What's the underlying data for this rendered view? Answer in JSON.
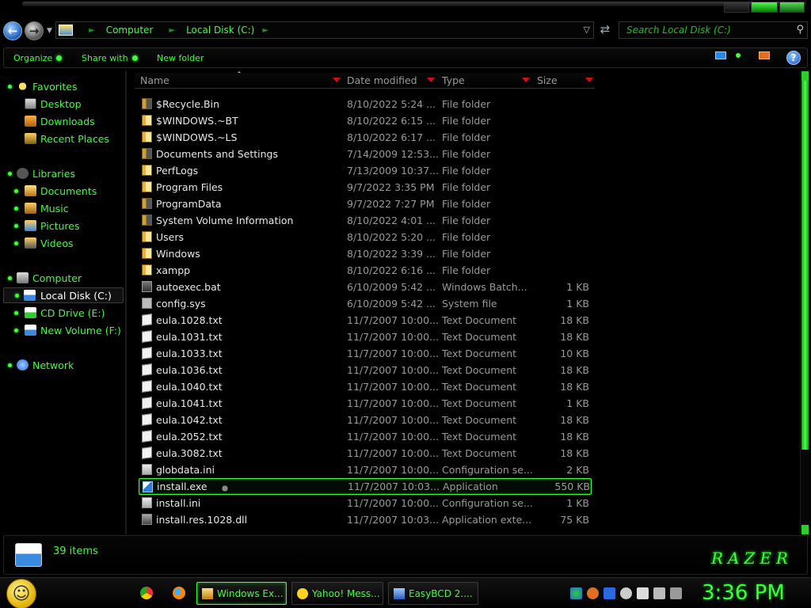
{
  "address": {
    "crumbs": [
      "Computer",
      "Local Disk (C:)"
    ],
    "search_placeholder": "Search Local Disk (C:)"
  },
  "commands": {
    "organize": "Organize",
    "share_with": "Share with",
    "new_folder": "New folder"
  },
  "nav": {
    "favorites": "Favorites",
    "desktop": "Desktop",
    "downloads": "Downloads",
    "recent_places": "Recent Places",
    "libraries": "Libraries",
    "documents": "Documents",
    "music": "Music",
    "pictures": "Pictures",
    "videos": "Videos",
    "computer": "Computer",
    "local_disk": "Local Disk (C:)",
    "cd_drive": "CD Drive (E:)",
    "new_volume": "New Volume (F:)",
    "network": "Network"
  },
  "columns": {
    "name": "Name",
    "date_modified": "Date modified",
    "type": "Type",
    "size": "Size"
  },
  "files": [
    {
      "name": "$Recycle.Bin",
      "date": "8/10/2022 5:24 ...",
      "type": "File folder",
      "size": "",
      "icon": "sysfolder"
    },
    {
      "name": "$WINDOWS.~BT",
      "date": "8/10/2022 6:15 ...",
      "type": "File folder",
      "size": "",
      "icon": "folder"
    },
    {
      "name": "$WINDOWS.~LS",
      "date": "8/10/2022 6:17 ...",
      "type": "File folder",
      "size": "",
      "icon": "folder"
    },
    {
      "name": "Documents and Settings",
      "date": "7/14/2009 12:53...",
      "type": "File folder",
      "size": "",
      "icon": "sysfolder"
    },
    {
      "name": "PerfLogs",
      "date": "7/13/2009 10:37...",
      "type": "File folder",
      "size": "",
      "icon": "folder"
    },
    {
      "name": "Program Files",
      "date": "9/7/2022 3:35 PM",
      "type": "File folder",
      "size": "",
      "icon": "folder"
    },
    {
      "name": "ProgramData",
      "date": "9/7/2022 7:27 PM",
      "type": "File folder",
      "size": "",
      "icon": "sysfolder"
    },
    {
      "name": "System Volume Information",
      "date": "8/10/2022 4:01 ...",
      "type": "File folder",
      "size": "",
      "icon": "sysfolder"
    },
    {
      "name": "Users",
      "date": "8/10/2022 5:20 ...",
      "type": "File folder",
      "size": "",
      "icon": "folder"
    },
    {
      "name": "Windows",
      "date": "8/10/2022 3:39 ...",
      "type": "File folder",
      "size": "",
      "icon": "folder"
    },
    {
      "name": "xampp",
      "date": "8/10/2022 6:16 ...",
      "type": "File folder",
      "size": "",
      "icon": "folder"
    },
    {
      "name": "autoexec.bat",
      "date": "6/10/2009 5:42 ...",
      "type": "Windows Batch...",
      "size": "1 KB",
      "icon": "bat"
    },
    {
      "name": "config.sys",
      "date": "6/10/2009 5:42 ...",
      "type": "System file",
      "size": "1 KB",
      "icon": "sys"
    },
    {
      "name": "eula.1028.txt",
      "date": "11/7/2007 10:00...",
      "type": "Text Document",
      "size": "18 KB",
      "icon": "doc"
    },
    {
      "name": "eula.1031.txt",
      "date": "11/7/2007 10:00...",
      "type": "Text Document",
      "size": "18 KB",
      "icon": "doc"
    },
    {
      "name": "eula.1033.txt",
      "date": "11/7/2007 10:00...",
      "type": "Text Document",
      "size": "10 KB",
      "icon": "doc"
    },
    {
      "name": "eula.1036.txt",
      "date": "11/7/2007 10:00...",
      "type": "Text Document",
      "size": "18 KB",
      "icon": "doc"
    },
    {
      "name": "eula.1040.txt",
      "date": "11/7/2007 10:00...",
      "type": "Text Document",
      "size": "18 KB",
      "icon": "doc"
    },
    {
      "name": "eula.1041.txt",
      "date": "11/7/2007 10:00...",
      "type": "Text Document",
      "size": "1 KB",
      "icon": "doc"
    },
    {
      "name": "eula.1042.txt",
      "date": "11/7/2007 10:00...",
      "type": "Text Document",
      "size": "18 KB",
      "icon": "doc"
    },
    {
      "name": "eula.2052.txt",
      "date": "11/7/2007 10:00...",
      "type": "Text Document",
      "size": "18 KB",
      "icon": "doc"
    },
    {
      "name": "eula.3082.txt",
      "date": "11/7/2007 10:00...",
      "type": "Text Document",
      "size": "18 KB",
      "icon": "doc"
    },
    {
      "name": "globdata.ini",
      "date": "11/7/2007 10:00...",
      "type": "Configuration se...",
      "size": "2 KB",
      "icon": "ini"
    },
    {
      "name": "install.exe",
      "date": "11/7/2007 10:03...",
      "type": "Application",
      "size": "550 KB",
      "icon": "exe",
      "selected": true
    },
    {
      "name": "install.ini",
      "date": "11/7/2007 10:00...",
      "type": "Configuration se...",
      "size": "1 KB",
      "icon": "ini"
    },
    {
      "name": "install.res.1028.dll",
      "date": "11/7/2007 10:03...",
      "type": "Application exte...",
      "size": "75 KB",
      "icon": "dll"
    }
  ],
  "details": {
    "count": "39 items",
    "logo": "RAZER"
  },
  "taskbar": {
    "items": [
      "Windows Ex...",
      "Yahoo! Mess...",
      "EasyBCD 2...."
    ],
    "clock": "3:36 PM"
  },
  "colors": {
    "accent": "#3cff3c",
    "selected_border": "#3cff3c",
    "header_arrow": "#d01010"
  }
}
